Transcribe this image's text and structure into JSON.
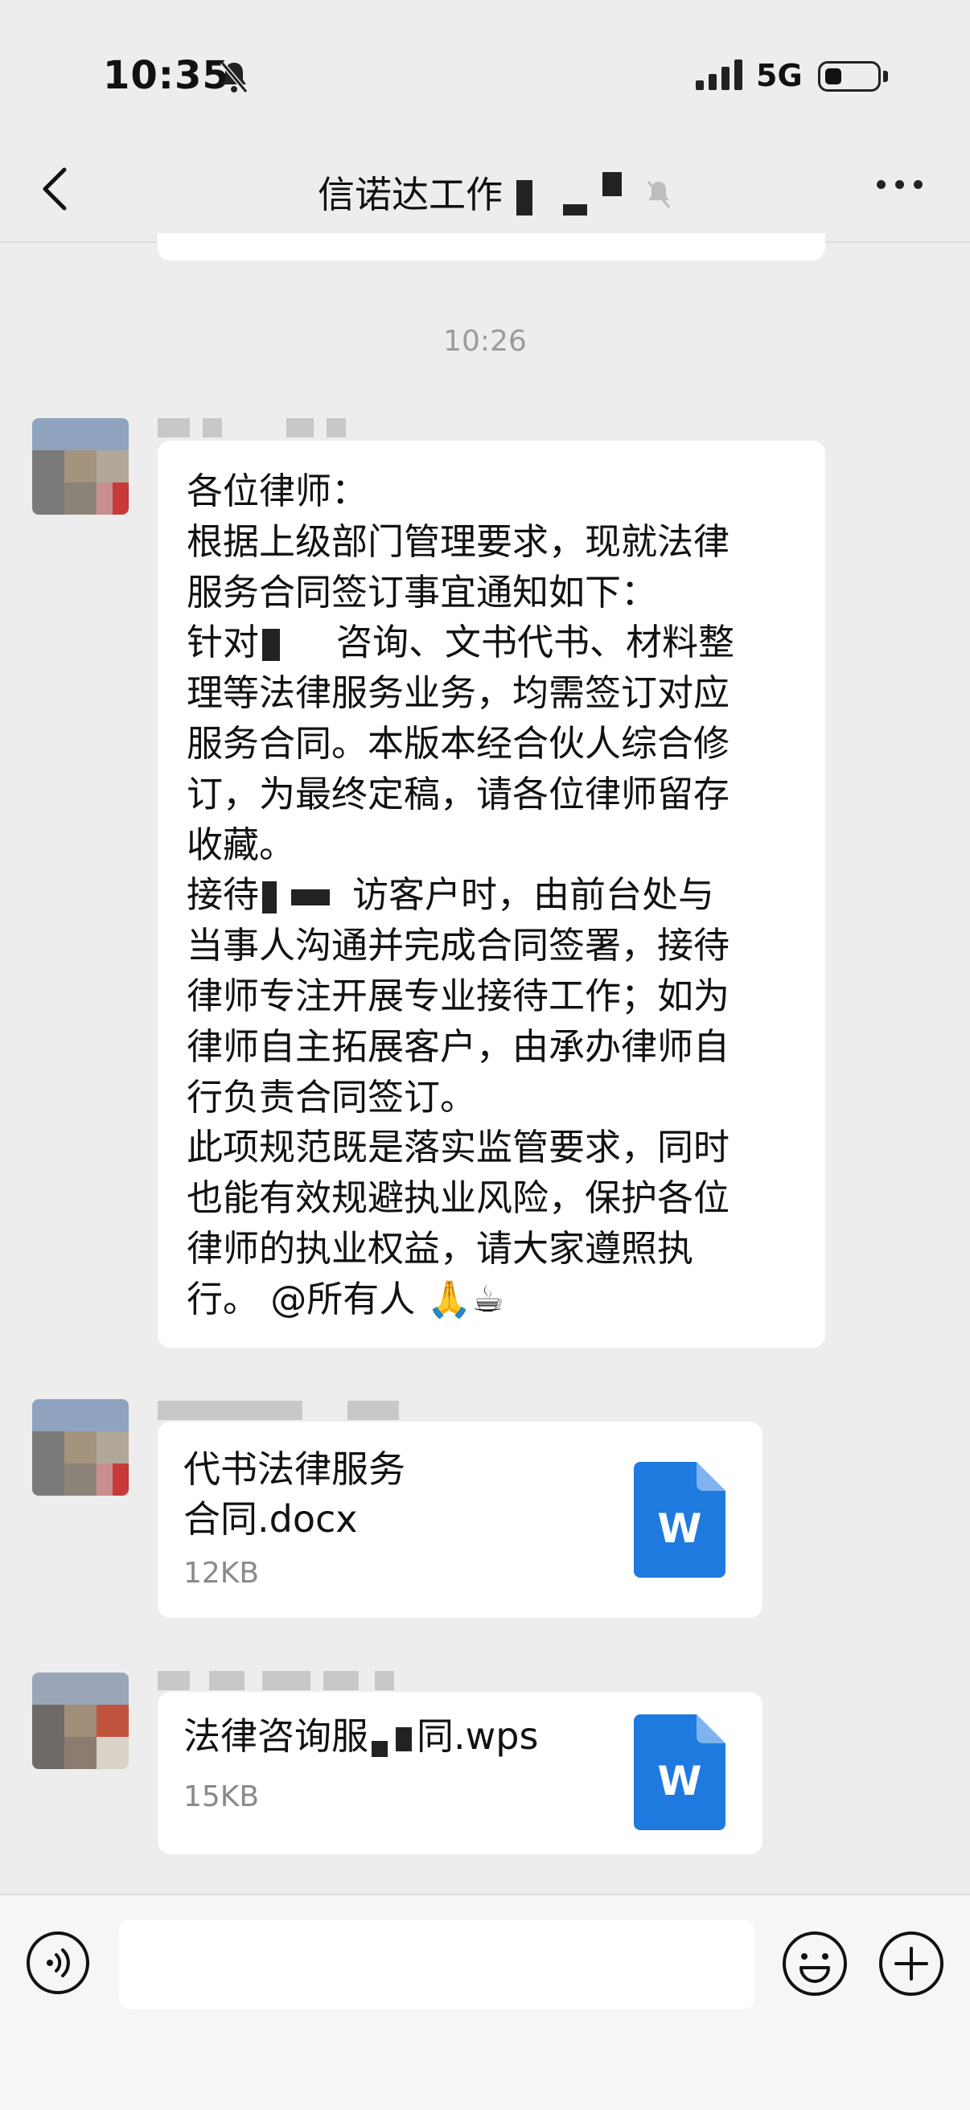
{
  "status_bar": {
    "time": "10:35",
    "network": "5G"
  },
  "header": {
    "title": "信诺达工作"
  },
  "timestamp": "10:26",
  "messages": [
    {
      "type": "text",
      "lines": [
        "各位律师：",
        "根据上级部门管理要求，现就法律",
        "服务合同签订事宜通知如下：",
        "针对",
        "咨询、文书代书、材料整",
        "理等法律服务业务，均需签订对应",
        "服务合同。本版本经合伙人综合修",
        "订，为最终定稿，请各位律师留存",
        "收藏。",
        "接待",
        "访客户时，由前台处与",
        "当事人沟通并完成合同签署，接待",
        "律师专注开展专业接待工作；如为",
        "律师自主拓展客户，由承办律师自",
        "行负责合同签订。",
        "此项规范既是落实监管要求，同时",
        "也能有效规避执业风险，保护各位",
        "律师的执业权益，请大家遵照执",
        "行。 @所有人"
      ],
      "emoji": "🙏☕"
    },
    {
      "type": "file",
      "name_line1": "代书法律服务",
      "name_line2": "合同.docx",
      "size": "12KB",
      "icon_letter": "W"
    },
    {
      "type": "file",
      "name_part1": "法律咨询服",
      "name_part2": "同.wps",
      "size": "15KB",
      "icon_letter": "W"
    }
  ],
  "colors": {
    "word_blue": "#1f7ae0",
    "background": "#ededed",
    "bubble": "#ffffff"
  }
}
